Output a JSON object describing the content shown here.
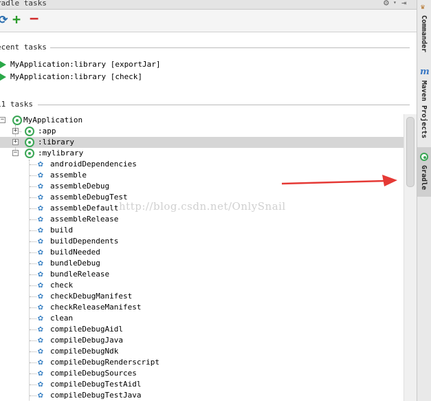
{
  "titlebar": {
    "title": "radle tasks"
  },
  "toolbar": {
    "refresh_glyph": "⟳",
    "add_glyph": "+",
    "remove_glyph": "−"
  },
  "recent": {
    "header": "ecent tasks",
    "items": [
      "MyApplication:library [exportJar]",
      "MyApplication:library [check]"
    ]
  },
  "all": {
    "header": "11 tasks",
    "root": "MyApplication",
    "modules": [
      ":app",
      ":library",
      ":mylibrary"
    ],
    "tasks": [
      "androidDependencies",
      "assemble",
      "assembleDebug",
      "assembleDebugTest",
      "assembleDefault",
      "assembleRelease",
      "build",
      "buildDependents",
      "buildNeeded",
      "bundleDebug",
      "bundleRelease",
      "check",
      "checkDebugManifest",
      "checkReleaseManifest",
      "clean",
      "compileDebugAidl",
      "compileDebugJava",
      "compileDebugNdk",
      "compileDebugRenderscript",
      "compileDebugSources",
      "compileDebugTestAidl",
      "compileDebugTestJava"
    ]
  },
  "side_tabs": [
    "Commander",
    "Maven Projects",
    "Gradle"
  ],
  "side_icons": {
    "maven": "m"
  },
  "watermark": "http://blog.csdn.net/OnlySnail",
  "colors": {
    "gradle_green": "#3aa655",
    "task_blue": "#3a82c4",
    "arrow_red": "#e53935",
    "selection": "#d6d6d6"
  },
  "icons": {
    "gear": "gear-icon",
    "task": "task-gear-icon",
    "run": "play-icon"
  }
}
